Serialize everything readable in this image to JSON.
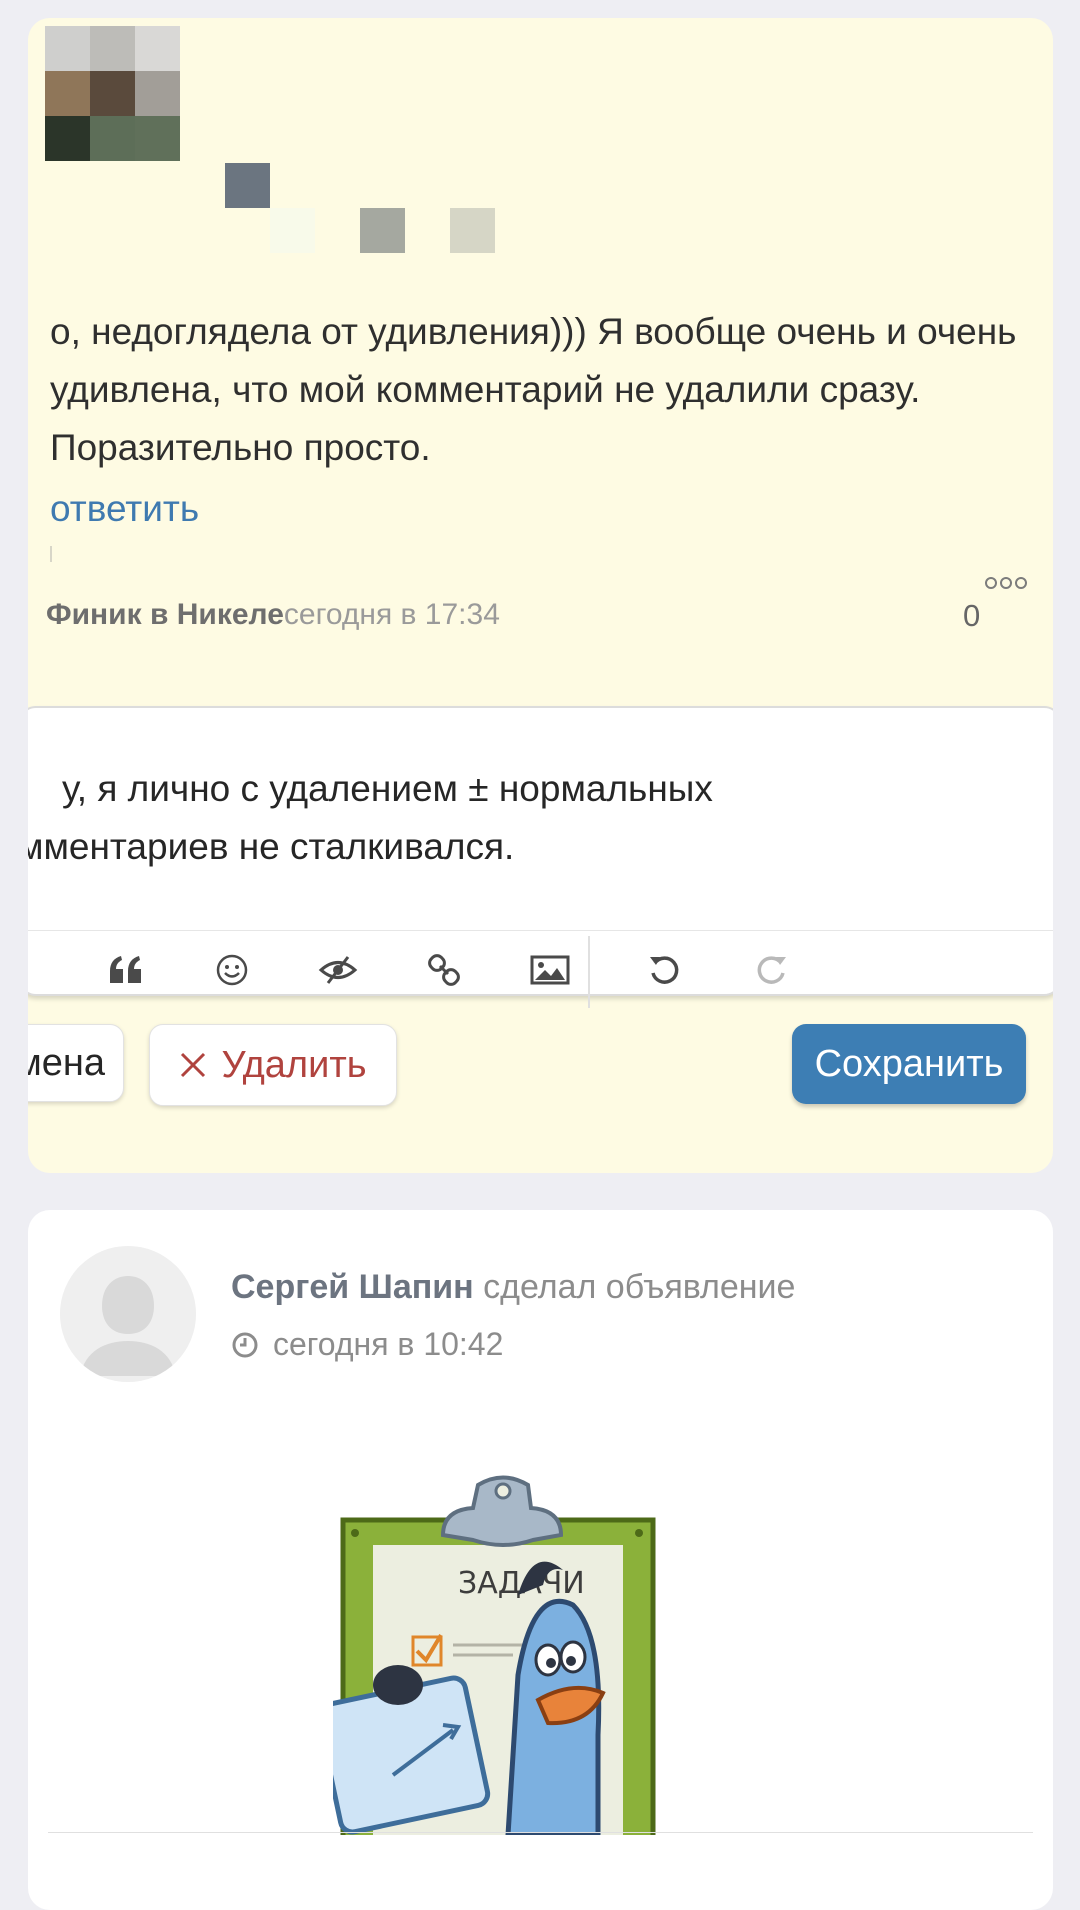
{
  "comment": {
    "text": "о, недоглядела от удивления)))  Я вообще очень и очень удивлена, что мой комментарий не удалили сразу. Поразительно просто.",
    "reply_label": "ответить"
  },
  "meta": {
    "author": "Финик в Никеле",
    "time": "сегодня в 17:34",
    "count": "0"
  },
  "editor": {
    "line1": "у, я лично с удалением ± нормальных",
    "line2": "мментариев не сталкивался.",
    "toolbar": [
      "quote-icon",
      "smile-icon",
      "spoiler-eye-icon",
      "link-icon",
      "image-icon",
      "undo-icon",
      "redo-icon"
    ]
  },
  "buttons": {
    "cancel": "мена",
    "delete": "Удалить",
    "save": "Сохранить"
  },
  "post": {
    "author": "Сергей Шапин",
    "action": "сделал объявление",
    "date": "сегодня в 10:42",
    "illustration_text": "ЗАДАЧИ"
  },
  "colors": {
    "comment_bg": "#fefbe3",
    "link": "#3f7ab0",
    "save_button": "#3d7eb4",
    "delete_text": "#b0433e"
  }
}
